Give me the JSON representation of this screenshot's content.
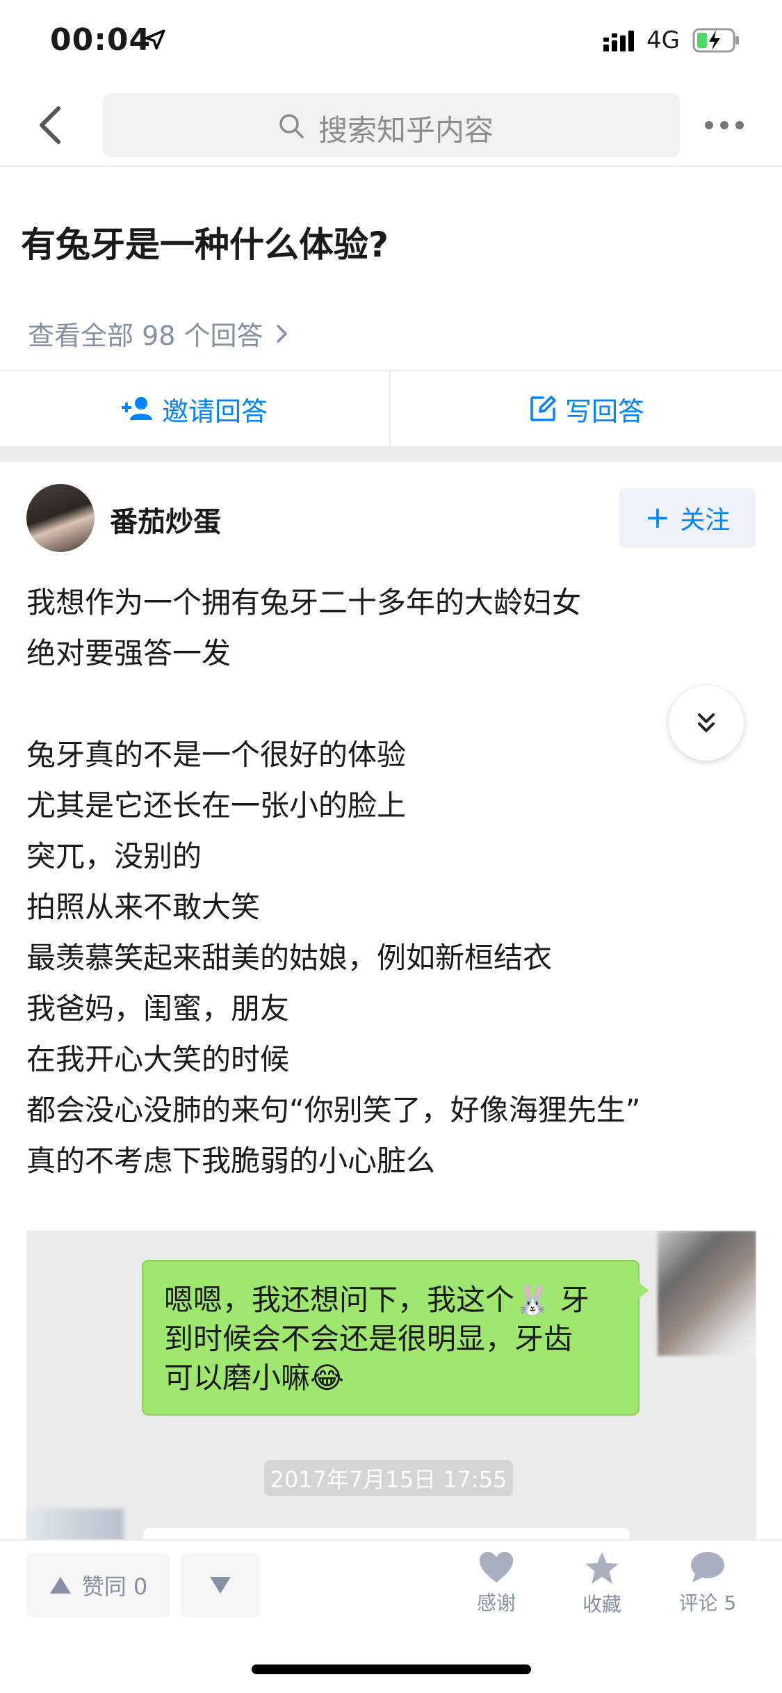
{
  "status_bar": {
    "time": "00:04",
    "network": "4G",
    "icons": [
      "location-arrow-icon",
      "signal-icon",
      "battery-charging-icon"
    ]
  },
  "nav": {
    "search_placeholder": "搜索知乎内容",
    "icons": [
      "back-arrow-icon",
      "search-icon",
      "more-icon"
    ]
  },
  "question": {
    "title": "有兔牙是一种什么体验?",
    "view_all": "查看全部 98 个回答"
  },
  "actions": {
    "invite": "邀请回答",
    "write": "写回答"
  },
  "answer": {
    "author": "番茄炒蛋",
    "follow_label": "关注",
    "lines": [
      "我想作为一个拥有兔牙二十多年的大龄妇女",
      "绝对要强答一发",
      "",
      "兔牙真的不是一个很好的体验",
      "尤其是它还长在一张小的脸上",
      "突兀，没别的",
      "拍照从来不敢大笑",
      "最羡慕笑起来甜美的姑娘，例如新桓结衣",
      "我爸妈，闺蜜，朋友",
      "在我开心大笑的时候",
      "都会没心没肺的来句“你别笑了，好像海狸先生”",
      "真的不考虑下我脆弱的小心脏么"
    ]
  },
  "chat_image": {
    "bubble_lines": [
      "嗯嗯，我还想问下，我这个🐰 牙",
      "到时候会不会还是很明显，牙齿",
      "可以磨小嘛😂"
    ],
    "timestamp": "2017年7月15日 17:55"
  },
  "bottom_bar": {
    "upvote_label": "赞同 0",
    "thanks": "感谢",
    "favorite": "收藏",
    "comment": "评论 5"
  },
  "colors": {
    "accent": "#0084ff",
    "muted": "#8590a6",
    "chat_green": "#9fe76f"
  }
}
